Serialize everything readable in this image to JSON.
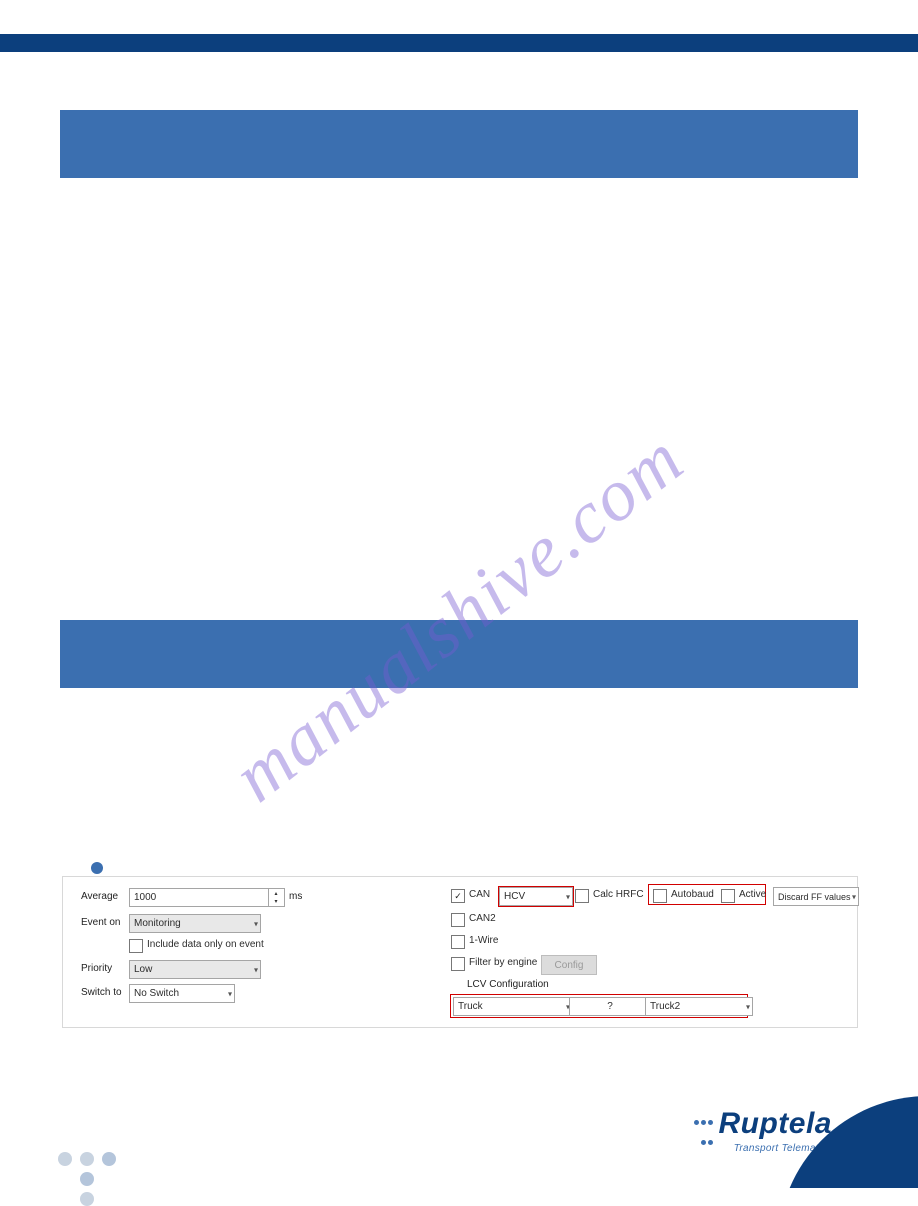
{
  "watermark": "manualshive.com",
  "logo": {
    "name": "Ruptela",
    "tagline": "Transport Telematics"
  },
  "screenshot": {
    "left": {
      "average_label": "Average",
      "average_value": "1000",
      "average_unit": "ms",
      "event_on_label": "Event on",
      "event_on_value": "Monitoring",
      "include_label": "Include data only on event",
      "priority_label": "Priority",
      "priority_value": "Low",
      "switch_label": "Switch to",
      "switch_value": "No Switch"
    },
    "right": {
      "can_label": "CAN",
      "can_mode": "HCV",
      "calc_hrfc_label": "Calc HRFC",
      "autobaud_label": "Autobaud",
      "active_label": "Active",
      "discard_value": "Discard FF values",
      "can2_label": "CAN2",
      "onewire_label": "1-Wire",
      "filter_label": "Filter by engine",
      "config_btn": "Config",
      "lcv_heading": "LCV Configuration",
      "lcv_group": "Truck",
      "lcv_question": "?",
      "lcv_sub": "Truck2"
    }
  }
}
